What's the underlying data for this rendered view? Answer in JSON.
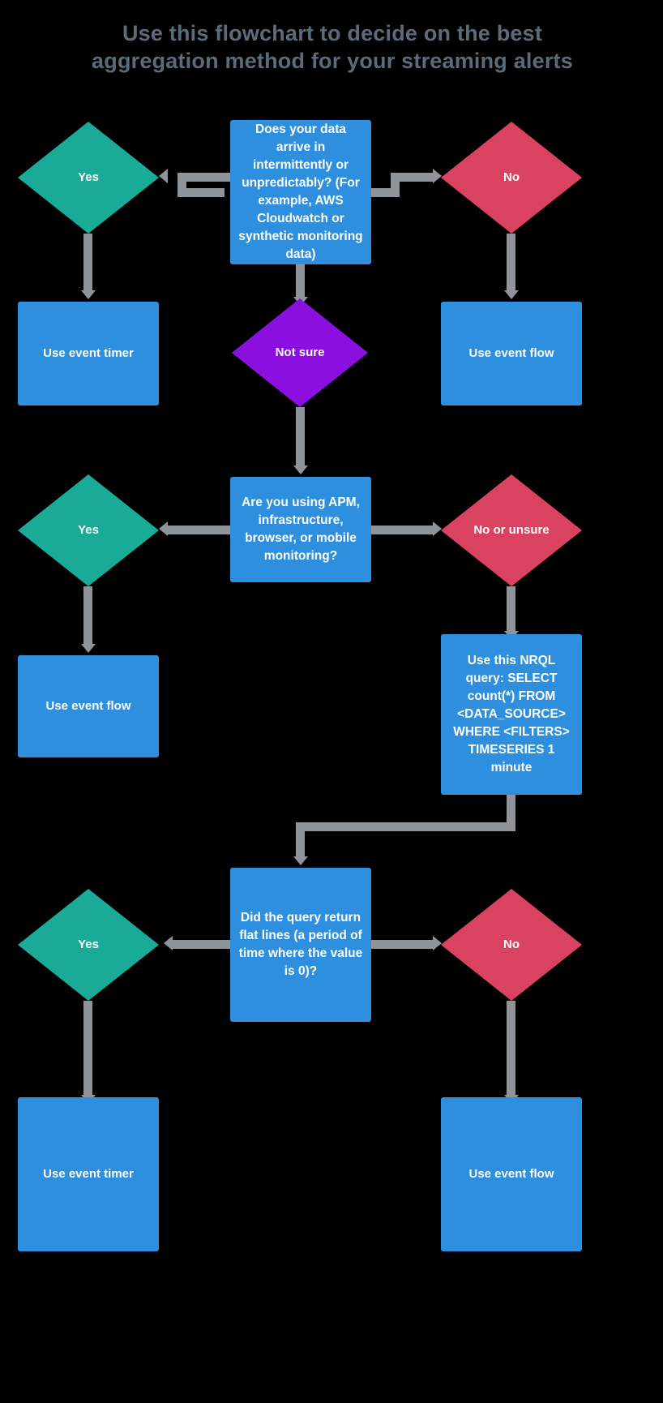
{
  "title": "Use this flowchart to decide on the best\naggregation method for your streaming alerts",
  "colors": {
    "background": "#000000",
    "title_text": "#5c6b7a",
    "process_box": "#2e8fdf",
    "decision_yes": "#1aab98",
    "decision_no": "#da4360",
    "decision_maybe": "#8b10e0",
    "connector": "#8e9499",
    "node_text": "#ffffff"
  },
  "chart_data": {
    "type": "diagram",
    "title": "Use this flowchart to decide on the best aggregation method for your streaming alerts",
    "nodes": [
      {
        "id": "q1",
        "shape": "rectangle",
        "color": "#2e8fdf",
        "text": "Does your data arrive in intermittently or unpredictably? (For example, AWS Cloudwatch or synthetic monitoring data)"
      },
      {
        "id": "q1-yes",
        "shape": "diamond",
        "color": "#1aab98",
        "text": "Yes"
      },
      {
        "id": "q1-no",
        "shape": "diamond",
        "color": "#da4360",
        "text": "No"
      },
      {
        "id": "q1-notsure",
        "shape": "diamond",
        "color": "#8b10e0",
        "text": "Not sure"
      },
      {
        "id": "r1-left",
        "shape": "rectangle",
        "color": "#2e8fdf",
        "text": "Use event timer"
      },
      {
        "id": "r1-right",
        "shape": "rectangle",
        "color": "#2e8fdf",
        "text": "Use event flow"
      },
      {
        "id": "q2",
        "shape": "rectangle",
        "color": "#2e8fdf",
        "text": "Are you using APM, infrastructure, browser, or mobile monitoring?"
      },
      {
        "id": "q2-yes",
        "shape": "diamond",
        "color": "#1aab98",
        "text": "Yes"
      },
      {
        "id": "q2-no",
        "shape": "diamond",
        "color": "#da4360",
        "text": "No or unsure"
      },
      {
        "id": "r2-left",
        "shape": "rectangle",
        "color": "#2e8fdf",
        "text": "Use event flow"
      },
      {
        "id": "r2-right",
        "shape": "rectangle",
        "color": "#2e8fdf",
        "text": "Use this NRQL query: SELECT count(*) FROM <DATA_SOURCE> WHERE <FILTERS> TIMESERIES 1 minute"
      },
      {
        "id": "q3",
        "shape": "rectangle",
        "color": "#2e8fdf",
        "text": "Did the query return flat lines (a period of time where the value is 0)?"
      },
      {
        "id": "q3-yes",
        "shape": "diamond",
        "color": "#1aab98",
        "text": "Yes"
      },
      {
        "id": "q3-no",
        "shape": "diamond",
        "color": "#da4360",
        "text": "No"
      },
      {
        "id": "r3-left",
        "shape": "rectangle",
        "color": "#2e8fdf",
        "text": "Use event timer"
      },
      {
        "id": "r3-right",
        "shape": "rectangle",
        "color": "#2e8fdf",
        "text": "Use event flow"
      }
    ],
    "edges": [
      {
        "from": "q1",
        "to": "q1-yes",
        "direction": "left"
      },
      {
        "from": "q1",
        "to": "q1-no",
        "direction": "right"
      },
      {
        "from": "q1",
        "to": "q1-notsure",
        "direction": "down"
      },
      {
        "from": "q1-yes",
        "to": "r1-left",
        "direction": "down"
      },
      {
        "from": "q1-no",
        "to": "r1-right",
        "direction": "down"
      },
      {
        "from": "q1-notsure",
        "to": "q2",
        "direction": "down"
      },
      {
        "from": "q2",
        "to": "q2-yes",
        "direction": "left"
      },
      {
        "from": "q2",
        "to": "q2-no",
        "direction": "right"
      },
      {
        "from": "q2-yes",
        "to": "r2-left",
        "direction": "down"
      },
      {
        "from": "q2-no",
        "to": "r2-right",
        "direction": "down"
      },
      {
        "from": "r2-right",
        "to": "q3",
        "direction": "down-left"
      },
      {
        "from": "q3",
        "to": "q3-yes",
        "direction": "left"
      },
      {
        "from": "q3",
        "to": "q3-no",
        "direction": "right"
      },
      {
        "from": "q3-yes",
        "to": "r3-left",
        "direction": "down"
      },
      {
        "from": "q3-no",
        "to": "r3-right",
        "direction": "down"
      }
    ]
  },
  "nodes": {
    "q1": "Does your data arrive in intermittently or unpredictably? (For example, AWS Cloudwatch or synthetic monitoring data)",
    "q1_yes": "Yes",
    "q1_no": "No",
    "q1_notsure": "Not sure",
    "r1_left": "Use event timer",
    "r1_right": "Use event flow",
    "q2": "Are you using APM, infrastructure, browser, or mobile monitoring?",
    "q2_yes": "Yes",
    "q2_no": "No or unsure",
    "r2_left": "Use event flow",
    "r2_right": "Use this NRQL query: SELECT count(*) FROM <DATA_SOURCE> WHERE <FILTERS> TIMESERIES 1 minute",
    "q3": "Did the query return flat lines (a period of time where the value is 0)?",
    "q3_yes": "Yes",
    "q3_no": "No",
    "r3_left": "Use event timer",
    "r3_right": "Use event flow"
  }
}
